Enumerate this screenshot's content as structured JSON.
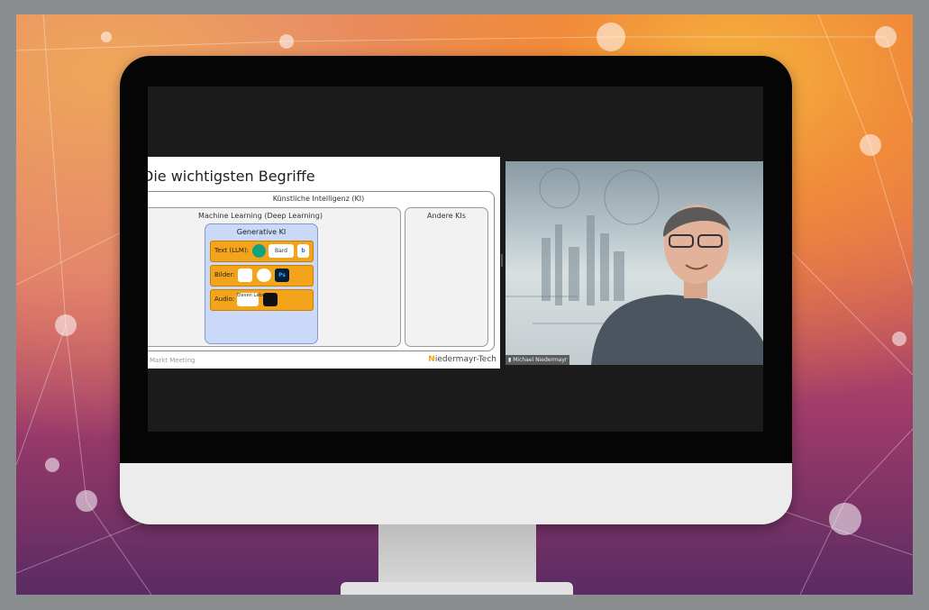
{
  "slide": {
    "title": "Die wichtigsten Begriffe",
    "ki_label": "Künstliche Intelligenz (KI)",
    "ml_label": "Machine Learning (Deep Learning)",
    "gen_label": "Generative KI",
    "rows": {
      "text_label": "Text (LLM):",
      "bilder_label": "Bilder:",
      "audio_label": "Audio:"
    },
    "logos": {
      "bard": "Bard",
      "bing": "b",
      "ps": "Ps",
      "eleven": "Eleven Labs"
    },
    "andere_label": "Andere KIs",
    "footer_left": "Markt Meeting",
    "footer_right_initial": "N",
    "footer_right_rest": "iedermayr-Tech"
  },
  "video": {
    "participant_name": "Michael Niedermayr"
  },
  "colors": {
    "accent_orange": "#f4a41a",
    "gen_blue": "#c9d9f7"
  }
}
